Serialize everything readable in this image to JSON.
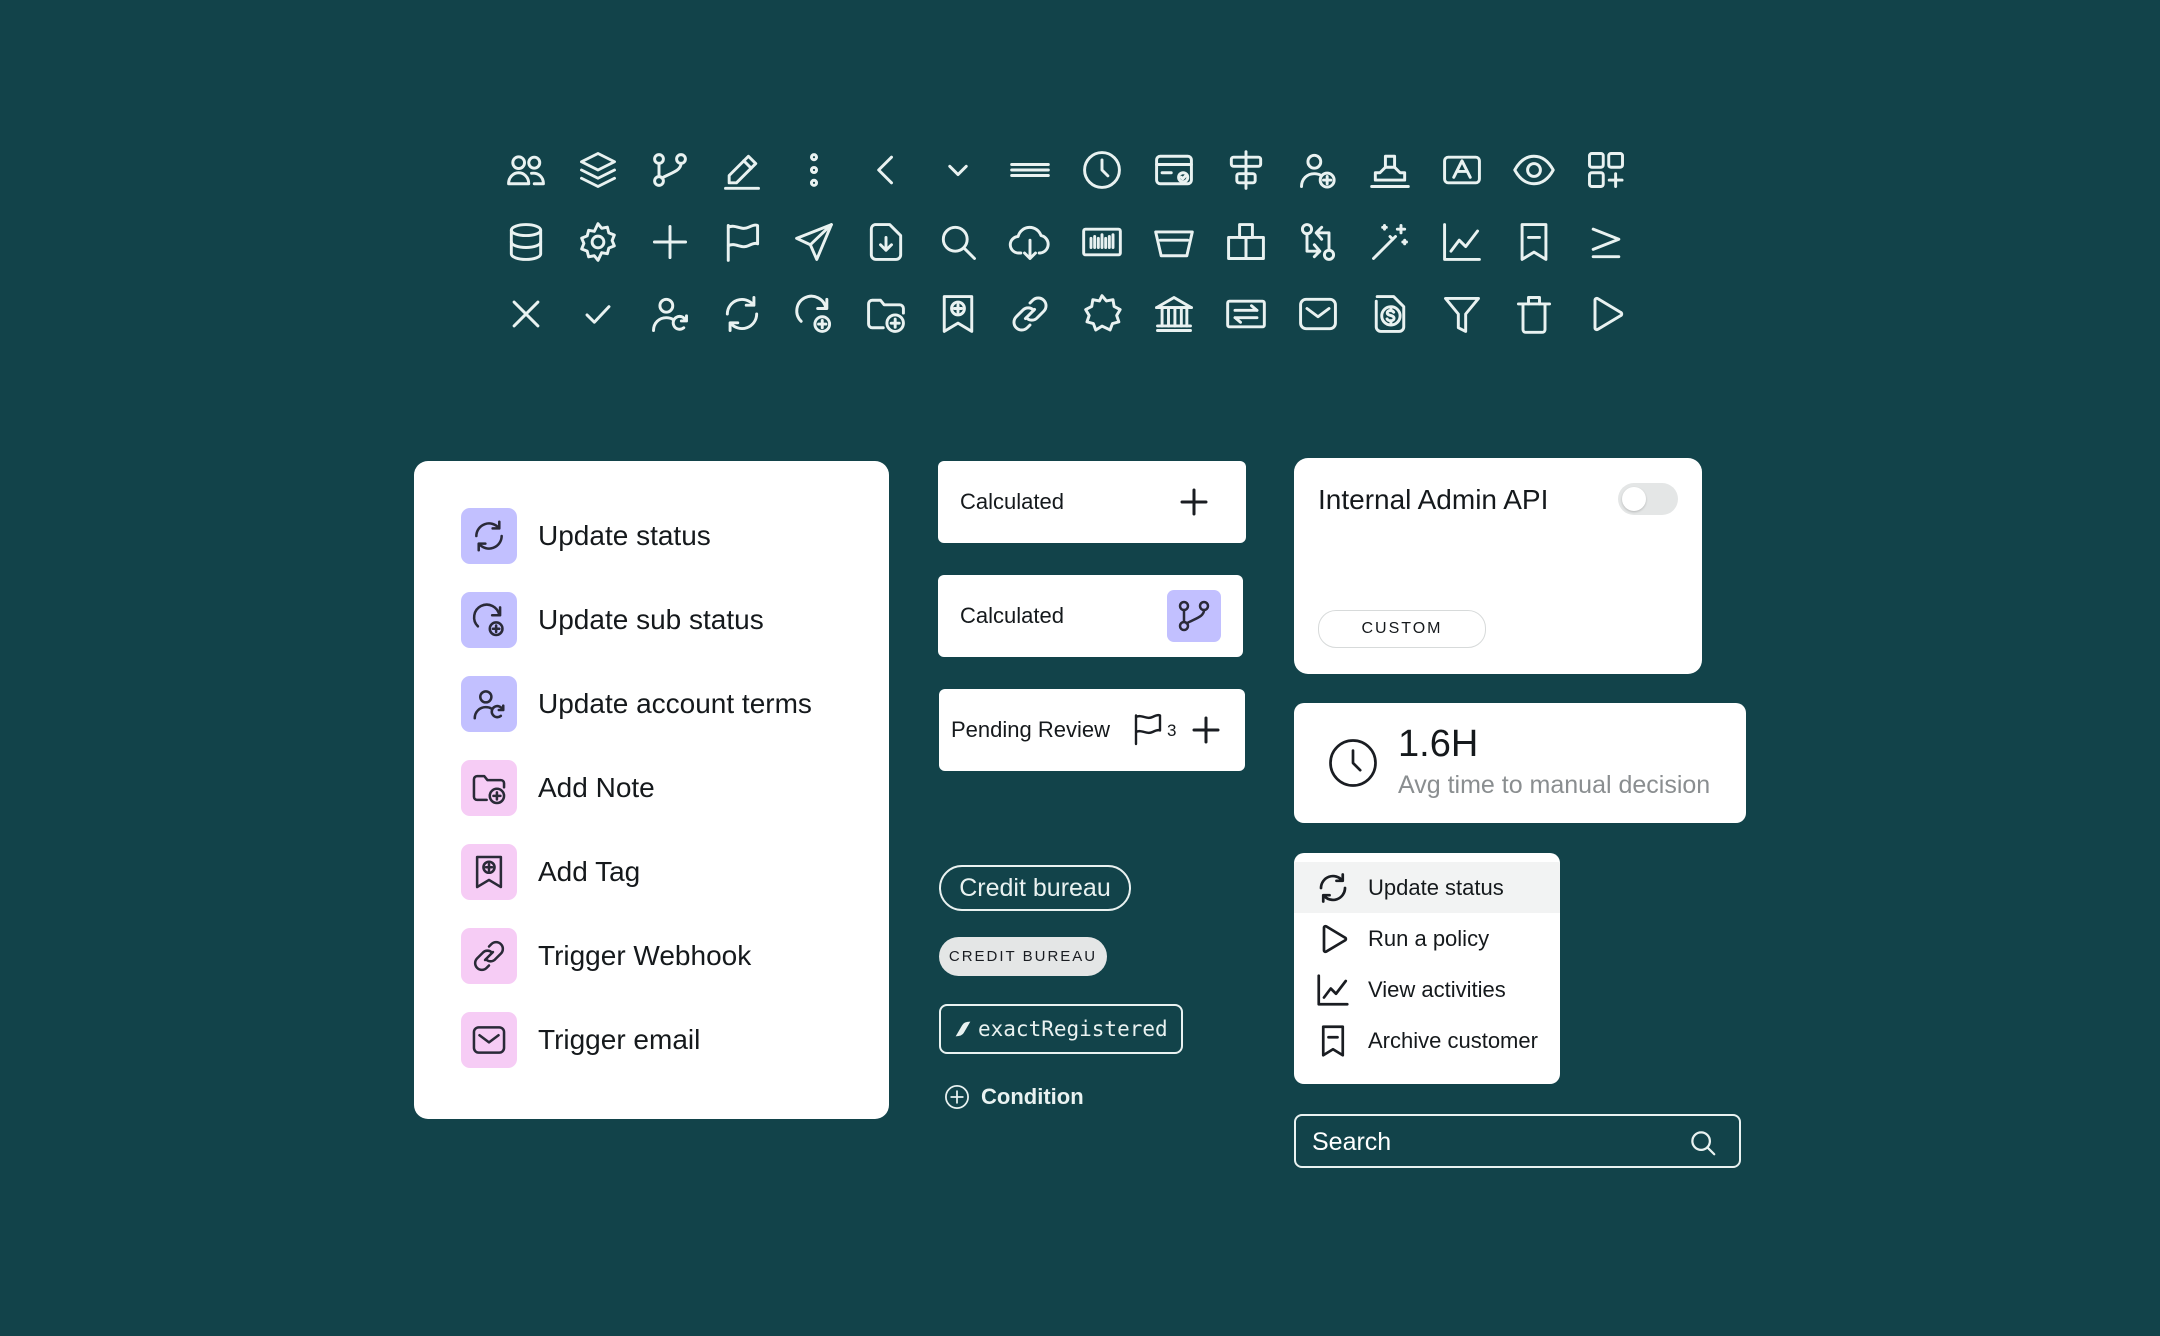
{
  "colors": {
    "background": "#12434a",
    "icon_stroke": "#e9f2f1",
    "tile_blue": "#c2c0ff",
    "tile_pink": "#f6ccf5"
  },
  "icon_grid": [
    "users-icon",
    "layers-icon",
    "branch-icon",
    "pencil-icon",
    "more-vertical-icon",
    "chevron-left-icon",
    "chevron-down-icon",
    "menu-icon",
    "clock-icon",
    "card-check-icon",
    "align-center-icon",
    "user-add-icon",
    "stamp-icon",
    "text-box-icon",
    "eye-icon",
    "grid-add-icon",
    "database-icon",
    "gear-icon",
    "plus-icon",
    "flag-icon",
    "send-icon",
    "file-download-icon",
    "search-icon",
    "cloud-download-icon",
    "barcode-icon",
    "basket-icon",
    "boxes-icon",
    "swap-icon",
    "magic-wand-icon",
    "line-chart-icon",
    "archive-icon",
    "greater-equal-icon",
    "close-icon",
    "check-icon",
    "user-refresh-icon",
    "refresh-icon",
    "refresh-add-icon",
    "folder-add-icon",
    "bookmark-add-icon",
    "link-icon",
    "badge-icon",
    "bank-icon",
    "transfer-icon",
    "mail-icon",
    "money-file-icon",
    "filter-icon",
    "trash-icon",
    "play-icon"
  ],
  "action_list": [
    {
      "label": "Update status",
      "icon": "refresh-icon",
      "tile": "blue"
    },
    {
      "label": "Update  sub status",
      "icon": "refresh-add-icon",
      "tile": "blue"
    },
    {
      "label": "Update account terms",
      "icon": "user-refresh-icon",
      "tile": "blue"
    },
    {
      "label": "Add Note",
      "icon": "folder-add-icon",
      "tile": "pink"
    },
    {
      "label": "Add Tag",
      "icon": "bookmark-add-icon",
      "tile": "pink"
    },
    {
      "label": "Trigger Webhook",
      "icon": "link-icon",
      "tile": "pink"
    },
    {
      "label": "Trigger email",
      "icon": "mail-icon",
      "tile": "pink"
    }
  ],
  "fields": {
    "calculated_1": "Calculated",
    "calculated_2": "Calculated",
    "pending_review": "Pending Review",
    "pending_review_count": "3"
  },
  "tags": {
    "credit_bureau": "Credit bureau",
    "credit_bureau_caps": "CREDIT BUREAU",
    "code_tag": "exactRegistered",
    "condition": "Condition"
  },
  "integration": {
    "title": "Internal Admin API",
    "badge": "CUSTOM",
    "toggle_on": false
  },
  "stat": {
    "value": "1.6H",
    "caption": "Avg time to manual decision"
  },
  "menu": [
    {
      "label": "Update status",
      "icon": "refresh-icon",
      "active": true
    },
    {
      "label": "Run a policy",
      "icon": "play-icon",
      "active": false
    },
    {
      "label": "View activities",
      "icon": "line-chart-icon",
      "active": false
    },
    {
      "label": "Archive customer",
      "icon": "archive-icon",
      "active": false
    }
  ],
  "search": {
    "placeholder": "Search"
  }
}
